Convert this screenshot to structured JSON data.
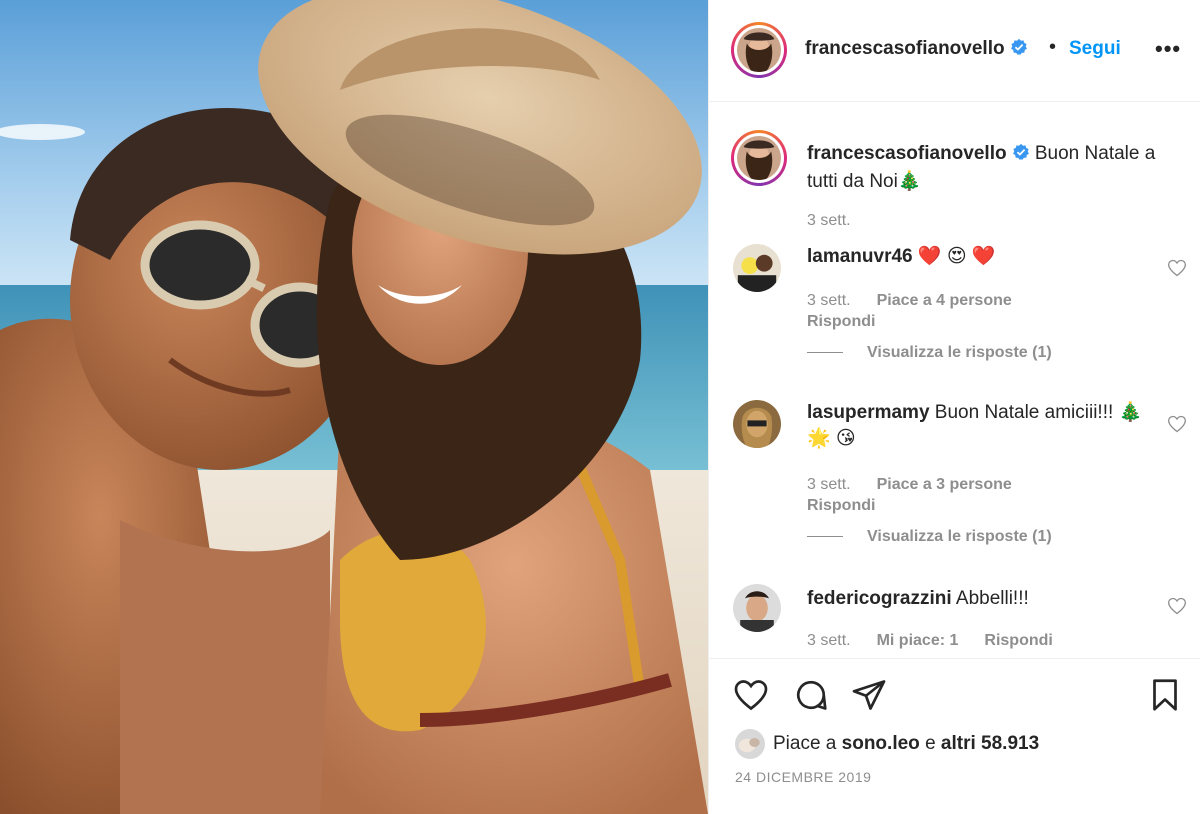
{
  "post": {
    "username": "francescasofianovello",
    "follow_label": "Segui",
    "more_label": "•••",
    "separator": "•",
    "caption": "Buon Natale a tutti da Noi🎄",
    "caption_time": "3 sett.",
    "likes_prefix": "Piace a",
    "likes_user": "sono.leo",
    "likes_mid": "e",
    "likes_others": "altri 58.913",
    "date": "24 DICEMBRE 2019"
  },
  "comments": [
    {
      "user": "lamanuvr46",
      "text": "❤️ 😍 ❤️",
      "time": "3 sett.",
      "likes": "Piace a 4 persone",
      "reply": "Rispondi",
      "view_replies": "Visualizza le risposte (1)"
    },
    {
      "user": "lasupermamy",
      "text": "Buon Natale amiciii!!! 🎄 🌟 😘",
      "time": "3 sett.",
      "likes": "Piace a 3 persone",
      "reply": "Rispondi",
      "view_replies": "Visualizza le risposte (1)"
    },
    {
      "user": "federicograzzini",
      "text": "Abbelli!!!",
      "time": "3 sett.",
      "likes": "Mi piace: 1",
      "reply": "Rispondi"
    }
  ],
  "icons": {
    "like": "heart-icon",
    "comment": "comment-icon",
    "share": "share-icon",
    "save": "bookmark-icon",
    "verified": "verified-icon"
  },
  "colors": {
    "accent": "#0095f6",
    "verified": "#3897f0",
    "text": "#262626",
    "muted": "#8e8e8e"
  }
}
